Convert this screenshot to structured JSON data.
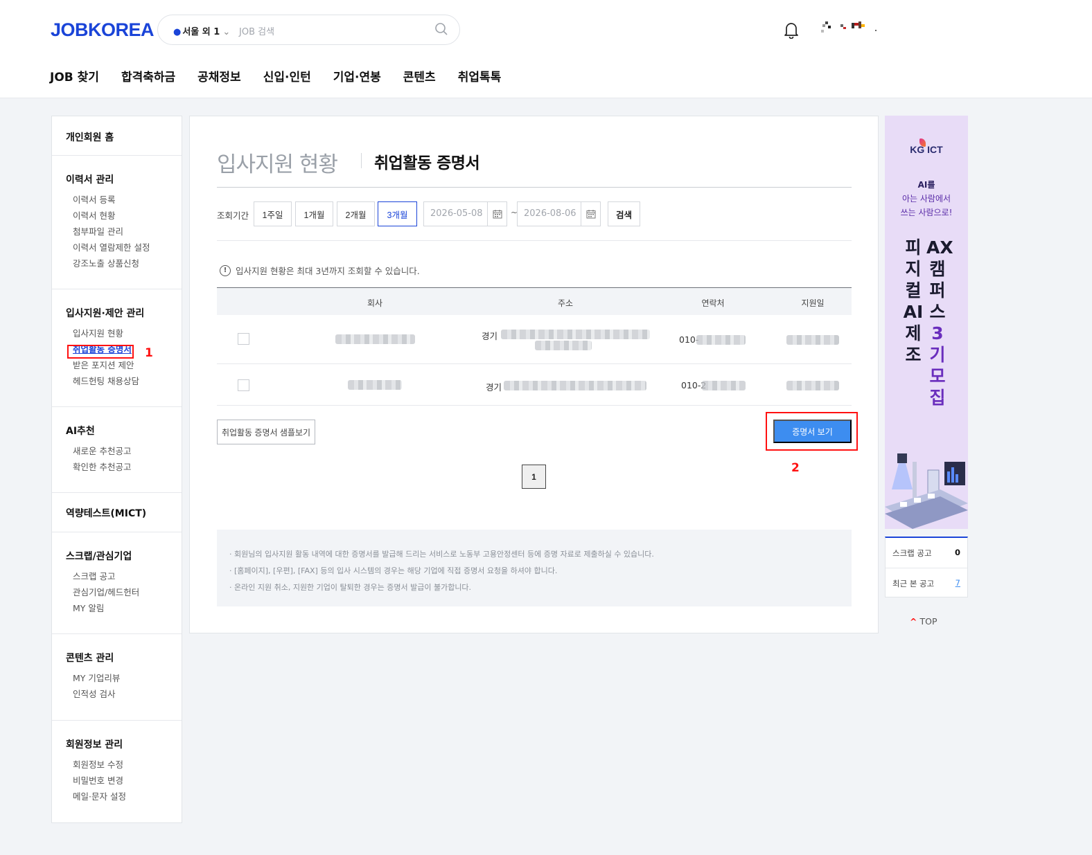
{
  "header": {
    "logo": "JOBKOREA",
    "location": "서울 외 1",
    "search_placeholder": "JOB 검색",
    "gnb": [
      "JOB 찾기",
      "합격축하금",
      "공채정보",
      "신입·인턴",
      "기업·연봉",
      "콘텐츠",
      "취업톡톡"
    ]
  },
  "sidebar": {
    "sections": [
      {
        "title": "개인회원 홈",
        "items": []
      },
      {
        "title": "이력서 관리",
        "items": [
          "이력서 등록",
          "이력서 현황",
          "첨부파일 관리",
          "이력서 열람제한 설정",
          "강조노출 상품신청"
        ]
      },
      {
        "title": "입사지원·제안 관리",
        "items": [
          "입사지원 현황",
          "취업활동 증명서",
          "받은 포지션 제안",
          "헤드헌팅 채용상담"
        ]
      },
      {
        "title": "AI추천",
        "items": [
          "새로운 추천공고",
          "확인한 추천공고"
        ]
      },
      {
        "title": "역량테스트(MICT)",
        "items": []
      },
      {
        "title": "스크랩/관심기업",
        "items": [
          "스크랩 공고",
          "관심기업/헤드헌터",
          "MY 알림"
        ]
      },
      {
        "title": "콘텐츠 관리",
        "items": [
          "MY 기업리뷰",
          "인적성 검사"
        ]
      },
      {
        "title": "회원정보 관리",
        "items": [
          "회원정보 수정",
          "비밀번호 변경",
          "메일·문자 설정"
        ]
      }
    ]
  },
  "main": {
    "title": "입사지원 현황",
    "subtitle": "취업활동 증명서",
    "period_label": "조회기간",
    "period_buttons": [
      "1주일",
      "1개월",
      "2개월",
      "3개월"
    ],
    "selected_period": "3개월",
    "date_from": "2026-05-08",
    "date_to": "2026-08-06",
    "tilde": "~",
    "search_button": "검색",
    "notice": "입사지원 현황은 최대 3년까지 조회할 수 있습니다.",
    "notice_icon": "!",
    "table": {
      "headers": [
        "회사",
        "주소",
        "연락처",
        "지원일"
      ],
      "rows": [
        {
          "address_prefix": "경기",
          "phone_prefix": "010-"
        },
        {
          "address_prefix": "경기",
          "phone_prefix": "010-2"
        }
      ]
    },
    "sample_button": "취업활동 증명서 샘플보기",
    "cert_button": "증명서 보기",
    "page": "1",
    "guide": [
      "· 회원님의 입사지원 활동 내역에 대한 증명서를 발급해 드리는 서비스로 노동부 고용안정센터 등에 증명 자료로 제출하실 수 있습니다.",
      "· [홈페이지], [우편], [FAX] 등의 입사 시스템의 경우는 해당 기업에 직접 증명서 요청을 하셔야 합니다.",
      "· 온라인 지원 취소, 지원한 기업이 탈퇴한 경우는 증명서 발급이 불가합니다."
    ],
    "annotations": [
      "1",
      "2"
    ]
  },
  "ad": {
    "brand": "KG ICT",
    "tagline": [
      "AI를",
      "아는 사람에서",
      "쓰는 사람으로!"
    ],
    "col1": [
      "피",
      "지",
      "컬",
      "AI",
      "제",
      "조"
    ],
    "col2": [
      "AX",
      "캠",
      "퍼",
      "스",
      "3",
      "기",
      "모",
      "집"
    ]
  },
  "side": {
    "scrap_label": "스크랩 공고",
    "scrap_count": "0",
    "recent_label": "최근 본 공고",
    "recent_count": "7",
    "top": "TOP"
  },
  "colors": {
    "brand": "#1a44d8",
    "accent": "#3d8df0",
    "annotation": "#ff1010"
  }
}
